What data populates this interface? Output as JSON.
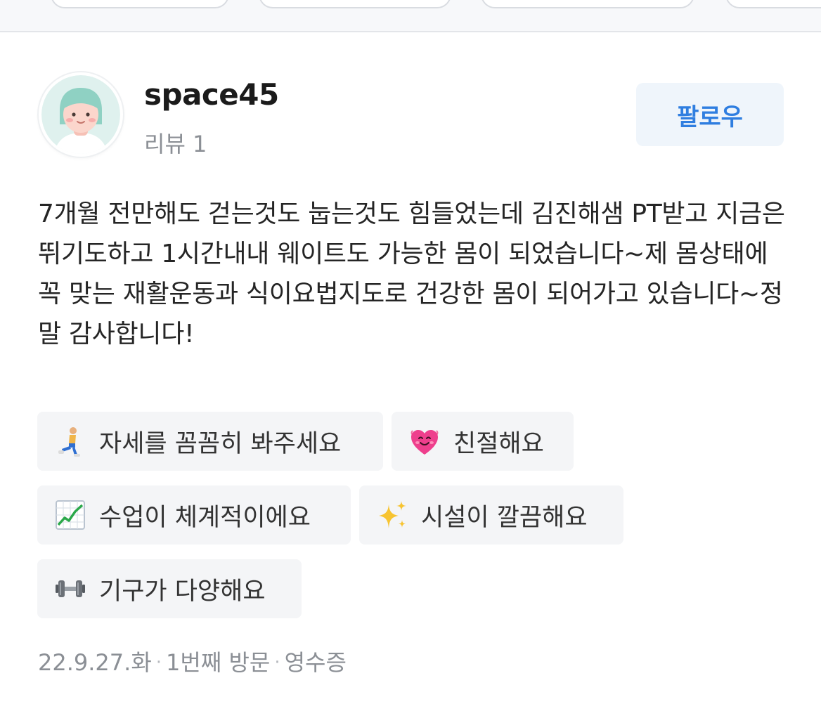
{
  "user": {
    "name": "space45",
    "review_count": "리뷰 1",
    "follow_label": "팔로우"
  },
  "review": {
    "text": "7개월 전만해도 걷는것도 눕는것도 힘들었는데 김진해샘 PT받고 지금은 뛰기도하고 1시간내내 웨이트도 가능한 몸이 되었습니다~제 몸상태에 꼭 맞는 재활운동과 식이요법지도로 건강한 몸이 되어가고 있습니다~정말 감사합니다!"
  },
  "keywords": [
    {
      "icon": "lunge-person-icon",
      "label": "자세를 꼼꼼히 봐주세요"
    },
    {
      "icon": "heart-face-icon",
      "label": "친절해요"
    },
    {
      "icon": "chart-increasing-icon",
      "label": "수업이 체계적이에요"
    },
    {
      "icon": "sparkles-icon",
      "label": "시설이 깔끔해요"
    },
    {
      "icon": "dumbbell-icon",
      "label": "기구가 다양해요"
    }
  ],
  "meta": {
    "date": "22.9.27.화",
    "visit": "1번째 방문",
    "proof": "영수증"
  },
  "colors": {
    "follow_text": "#2f7ee0",
    "follow_bg": "#eff5fb",
    "chip_bg": "#f4f5f7",
    "muted": "#8b8f95"
  }
}
